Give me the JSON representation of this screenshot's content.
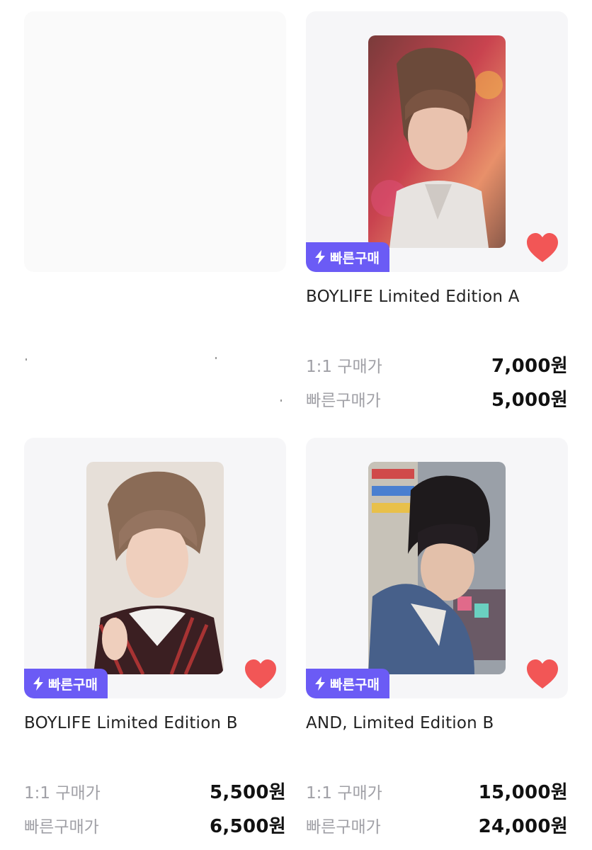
{
  "badge_label": "빠른구매",
  "labels": {
    "one_to_one": "1:1 구매가",
    "quick": "빠른구매가"
  },
  "accent_color": "#6b5bf5",
  "heart_color": "#f25656",
  "products": [
    {
      "title": "BOYLIFE Limited Edition A",
      "one_to_one_price": "7,000원",
      "quick_price": "5,000원",
      "image": "photocard-red-background"
    },
    {
      "title": "BOYLIFE Limited Edition B",
      "one_to_one_price": "5,500원",
      "quick_price": "6,500원",
      "image": "photocard-beige-background"
    },
    {
      "title": "AND, Limited Edition B",
      "one_to_one_price": "15,000원",
      "quick_price": "24,000원",
      "image": "photocard-store-shelf"
    }
  ]
}
